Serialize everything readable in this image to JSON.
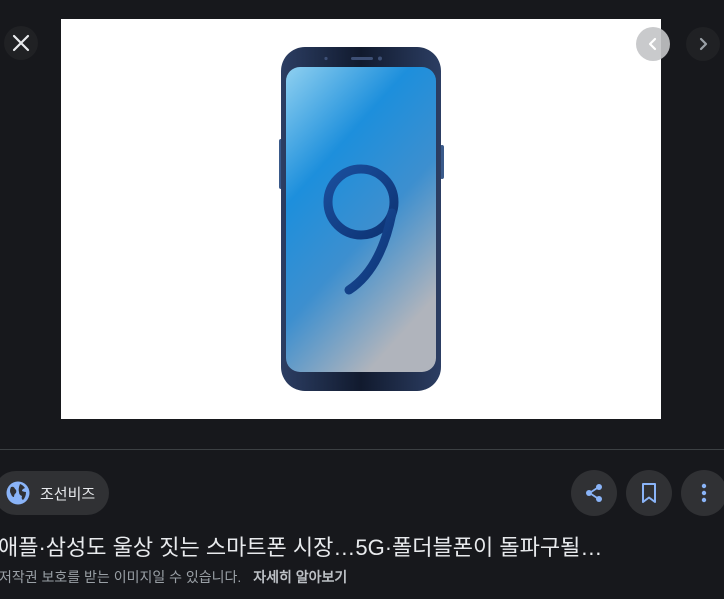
{
  "viewer": {
    "close_icon": "close-icon",
    "prev_icon": "chevron-left-icon",
    "next_icon": "chevron-right-icon"
  },
  "image": {
    "subject": "Samsung Galaxy S9 smartphone, blue",
    "screen_colors": [
      "#8fd0f0",
      "#1784d6",
      "#b0b4bc"
    ],
    "digit_on_screen": "9"
  },
  "source": {
    "icon": "globe-icon",
    "name": "조선비즈"
  },
  "actions": {
    "share_icon": "share-icon",
    "save_icon": "bookmark-icon",
    "more_icon": "more-vert-icon",
    "accent": "#8ab4f8"
  },
  "result": {
    "title": "애플·삼성도 울상 짓는 스마트폰 시장…5G·폴더블폰이 돌파구될…",
    "copyright_notice": "저작권 보호를 받는 이미지일 수 있습니다.",
    "learn_more": "자세히 알아보기"
  }
}
